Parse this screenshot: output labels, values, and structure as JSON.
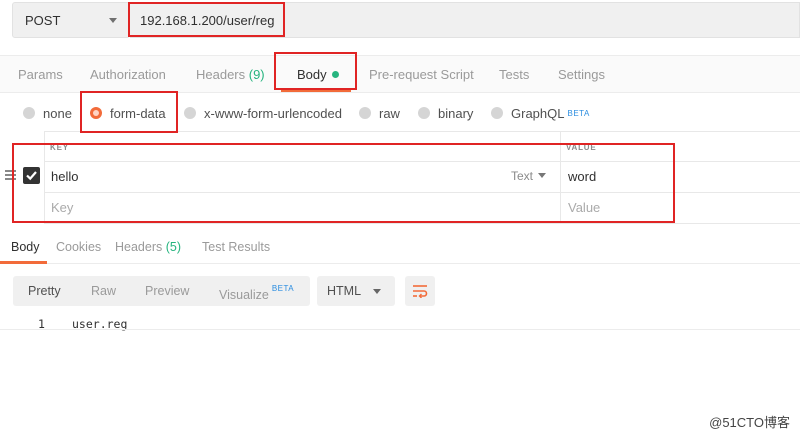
{
  "request": {
    "method": "POST",
    "url": "192.168.1.200/user/reg"
  },
  "request_tabs": [
    {
      "label": "Params"
    },
    {
      "label": "Authorization"
    },
    {
      "label": "Headers ",
      "count": "(9)"
    },
    {
      "label": "Body",
      "active": true
    },
    {
      "label": "Pre-request Script"
    },
    {
      "label": "Tests"
    },
    {
      "label": "Settings"
    }
  ],
  "body_types": [
    {
      "label": "none"
    },
    {
      "label": "form-data",
      "checked": true
    },
    {
      "label": "x-www-form-urlencoded"
    },
    {
      "label": "raw"
    },
    {
      "label": "binary"
    },
    {
      "label": "GraphQL",
      "badge": "BETA"
    }
  ],
  "params_table": {
    "key_header": "KEY",
    "value_header": "VALUE",
    "rows": [
      {
        "key": "hello",
        "type": "Text",
        "value": "word",
        "checked": true
      }
    ],
    "new_row": {
      "key_placeholder": "Key",
      "value_placeholder": "Value"
    }
  },
  "response_tabs": [
    {
      "label": "Body",
      "active": true
    },
    {
      "label": "Cookies"
    },
    {
      "label": "Headers ",
      "count": "(5)"
    },
    {
      "label": "Test Results"
    }
  ],
  "response_toolbar": {
    "views": [
      {
        "label": "Pretty",
        "active": true
      },
      {
        "label": "Raw"
      },
      {
        "label": "Preview"
      },
      {
        "label": "Visualize",
        "badge": "BETA"
      }
    ],
    "format": "HTML"
  },
  "response_body": {
    "lines": [
      {
        "number": "1",
        "text": "user.reg"
      }
    ]
  },
  "watermark": "@51CTO博客",
  "colors": {
    "accent": "#f26b3a",
    "success": "#26b47f",
    "highlight": "#e02424",
    "beta": "#2b8de0"
  },
  "icons": [
    "chevron-down-icon",
    "drag-handle-icon",
    "checkmark-icon",
    "wrap-lines-icon"
  ]
}
